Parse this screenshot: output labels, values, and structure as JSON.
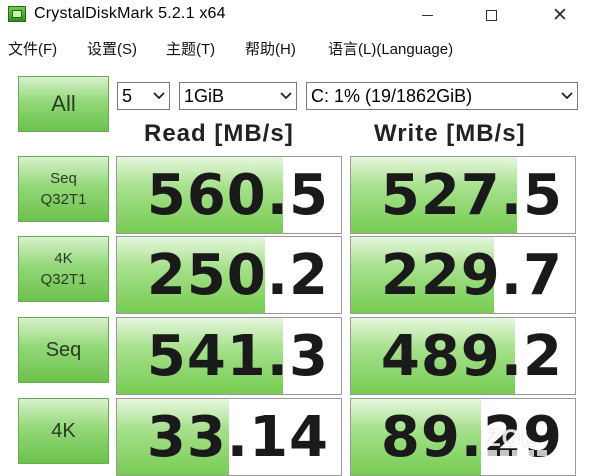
{
  "window": {
    "title": "CrystalDiskMark 5.2.1 x64",
    "minimize_icon": "minimize-icon",
    "maximize_icon": "maximize-icon",
    "close_icon": "close-icon",
    "close_glyph": "✕"
  },
  "menu": [
    {
      "label": "文件(F)"
    },
    {
      "label": "设置(S)"
    },
    {
      "label": "主题(T)"
    },
    {
      "label": "帮助(H)"
    },
    {
      "label": "语言(L)(Language)"
    }
  ],
  "controls": {
    "all_label": "All",
    "test_count": "5",
    "test_size": "1GiB",
    "drive": "C: 1% (19/1862GiB)"
  },
  "headers": {
    "read": "Read [MB/s]",
    "write": "Write [MB/s]"
  },
  "tests": [
    {
      "line1": "Seq",
      "line2": "Q32T1",
      "read": "560.5",
      "write": "527.5",
      "read_level": 0.74,
      "write_level": 0.74
    },
    {
      "line1": "4K",
      "line2": "Q32T1",
      "read": "250.2",
      "write": "229.7",
      "read_level": 0.66,
      "write_level": 0.64
    },
    {
      "line1": "Seq",
      "line2": "",
      "read": "541.3",
      "write": "489.2",
      "read_level": 0.74,
      "write_level": 0.73
    },
    {
      "line1": "4K",
      "line2": "",
      "read": "33.14",
      "write": "89.29",
      "read_level": 0.5,
      "write_level": 0.58
    }
  ],
  "watermark": {
    "text": "ZOL"
  },
  "colors": {
    "accent_green": "#77cc52",
    "button_green": "#93d878"
  }
}
